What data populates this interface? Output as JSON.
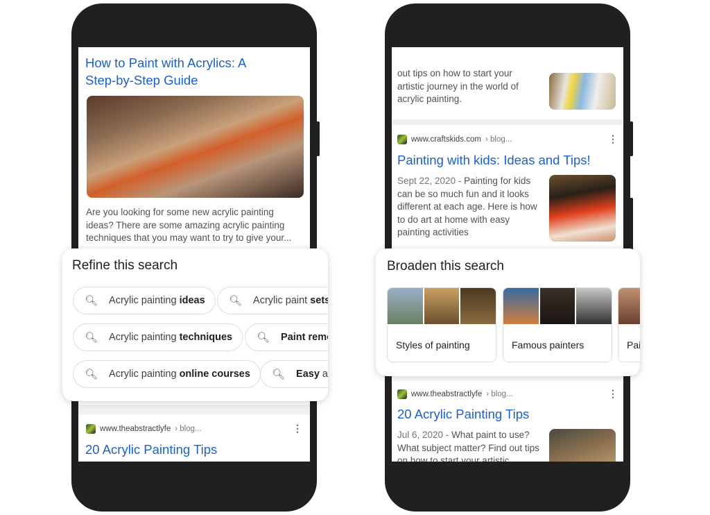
{
  "left_phone": {
    "result1": {
      "title": "How to Paint with Acrylics: A Step-by-Step Guide",
      "snippet": "Are you looking for some new acrylic painting ideas? There are some amazing acrylic painting techniques that you may want to try to give your..."
    },
    "refine": {
      "heading": "Refine this search",
      "chips": [
        {
          "prefix": "Acrylic painting",
          "bold": "ideas"
        },
        {
          "prefix": "Acrylic paint",
          "bold": "sets"
        },
        {
          "prefix": "Acrylic painting",
          "bold": "techniques"
        },
        {
          "prefix": "",
          "bold": "Paint remo"
        },
        {
          "prefix": "Acrylic painting",
          "bold": "online courses"
        },
        {
          "prefix": "ac",
          "bold": "Easy"
        }
      ]
    },
    "result2": {
      "site": "www.theabstractlyfe",
      "crumb": "› blog...",
      "title": "20 Acrylic Painting Tips"
    }
  },
  "right_phone": {
    "result0": {
      "snippet": "out tips on how to start your artistic journey in the world of acrylic painting."
    },
    "result1": {
      "site": "www.craftskids.com",
      "crumb": "› blog...",
      "title": "Painting with kids: Ideas and Tips!",
      "date": "Sept 22, 2020 -",
      "snippet": "Painting for kids can be so much fun and it looks different at each age. Here is how to do art at home with easy painting activities"
    },
    "broaden": {
      "heading": "Broaden this search",
      "tiles": [
        "Styles of painting",
        "Famous painters",
        "Pai"
      ]
    },
    "result2": {
      "site": "www.theabstractlyfe",
      "crumb": "› blog...",
      "title": "20 Acrylic Painting Tips",
      "date": "Jul 6, 2020 -",
      "snippet": "What paint to use? What subject matter? Find out tips on how to start your artistic"
    }
  },
  "icons": {
    "search": "search-icon",
    "more": "more-vert-icon",
    "favicon": "site-favicon"
  },
  "colors": {
    "link": "#1a5fd6",
    "phone": "#202020"
  }
}
